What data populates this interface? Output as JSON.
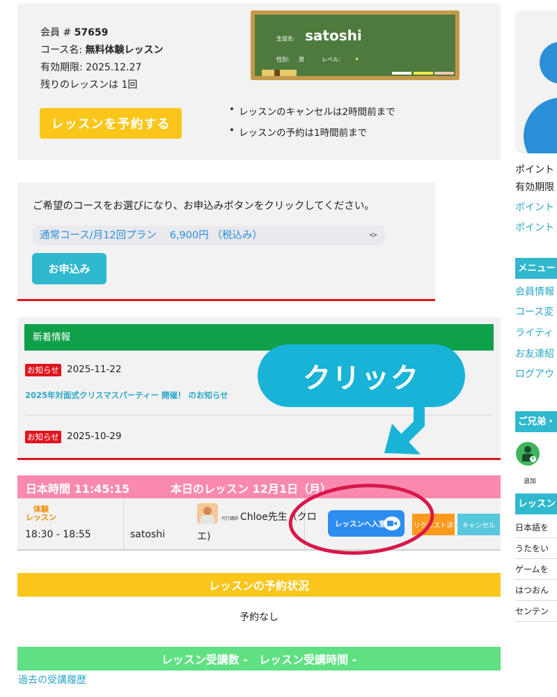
{
  "member": {
    "number_label": "会員 # ",
    "number": "57659",
    "course_label": "コース名: ",
    "course": "無料体験レッスン",
    "expiry": "有効期限: 2025.12.27",
    "remaining": "残りのレッスンは 1回",
    "reserve_button": "レッスンを予約する"
  },
  "chalkboard": {
    "name_label": "生徒名:",
    "name": "satoshi",
    "gender_label": "性別:",
    "gender": "男",
    "level_label": "レベル："
  },
  "rules": [
    "レッスンのキャンセルは2時間前まで",
    "レッスンの予約は1時間前まで"
  ],
  "course_select": {
    "prompt": "ご希望のコースをお選びになり、お申込みボタンをクリックしてください。",
    "selected": "通常コース/月12回プラン　 6,900円 （税込み）",
    "apply_button": "お申込み"
  },
  "news": {
    "header": "新着情報",
    "items": [
      {
        "badge": "お知らせ",
        "date": "2025-11-22",
        "title": "2025年対面式クリスマスパーティー 開催！ のお知らせ"
      },
      {
        "badge": "お知らせ",
        "date": "2025-10-29"
      }
    ]
  },
  "today": {
    "time_label": "日本時間 11:45:15",
    "lesson_label": "本日のレッスン 12月1日（月）",
    "type_line1": "体験",
    "type_line2": "レッスン",
    "time": "18:30 - 18:55",
    "student": "satoshi",
    "teacher_role": "代行講師",
    "teacher_name": "Chloe先生（クロ",
    "teacher_name_cont": "エ)",
    "enter_button": "レッスンへ入室",
    "request_button": "リクエスト済",
    "cancel_button": "キャンセル"
  },
  "reservation": {
    "header": "レッスンの予約状況",
    "status": "予約なし"
  },
  "lesson_count": {
    "header": "レッスン受講数 -　レッスン受講時間 -",
    "history_link": "過去の受講履歴"
  },
  "sidebar": {
    "points_line1": "ポイント",
    "points_line2": "有効期限",
    "point_link1": "ポイント",
    "point_link2": "ポイント",
    "menu_header": "メニュー",
    "menu_items": [
      "会員情報",
      "コース変",
      "ライティ",
      "お友達紹",
      "ログアウ"
    ],
    "sibling_header": "ご兄弟・",
    "add_label": "追加",
    "lesson_header": "レッスン",
    "lesson_items": [
      "日本語を",
      "うたをい",
      "ゲームを",
      "はつおん",
      "センテン"
    ]
  },
  "annotation": {
    "bubble": "クリック"
  },
  "colors": {
    "yellow": "#fbc61a",
    "teal": "#2fb8ce",
    "green": "#0fa04a",
    "pink": "#f98aae",
    "red": "#e0141e",
    "blue": "#2d8cf0",
    "annotation_red": "#d8174a"
  }
}
